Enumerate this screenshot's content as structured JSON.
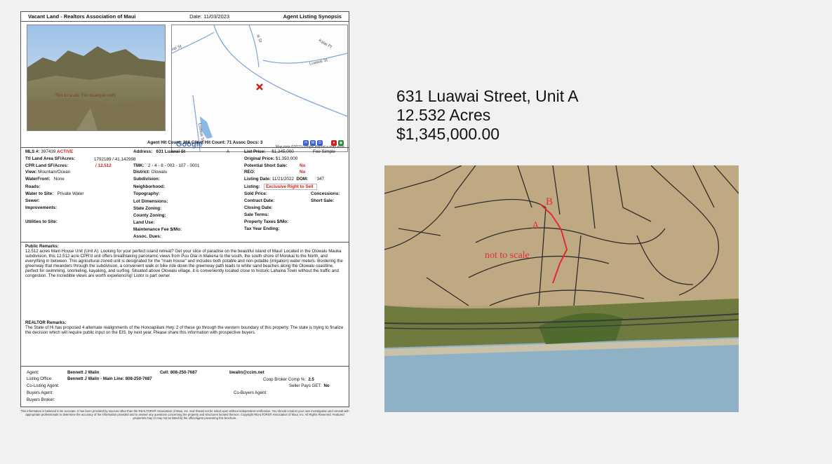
{
  "header": {
    "left": "Vacant Land - Realtors Association of Maui",
    "date": "Date:  11/03/2023",
    "right": "Agent Listing Synopsis"
  },
  "photo": {
    "watermark": "Not to scale. For example only"
  },
  "map": {
    "street_labels": [
      "Kalai Pl",
      "Luawai St",
      "Luawai St",
      "ai St",
      "wai St"
    ],
    "google": "Google",
    "attribution": "Map data ©2023 Google   Report a map error"
  },
  "counts": {
    "text": "Agent Hit Count:  266   Client Hit Count:  71    Assoc Docs:  3"
  },
  "colors": {
    "active": "#cc1f1f",
    "annotation": "#dd3333",
    "icon_blue": "#3a5fc8",
    "icon_red": "#d02020"
  },
  "col1": [
    {
      "k": "MLS #:",
      "v": "397439",
      "badge": "ACTIVE"
    },
    {
      "k": "Ttl Land Area SF/Acres:",
      "v": "1792189  /  41.142998"
    },
    {
      "k": "CPR Land SF/Acres:",
      "v": "/ 12.512"
    },
    {
      "k": "View:",
      "v": "Mountain/Ocean"
    },
    {
      "k": "WaterFront:",
      "v": "None"
    },
    {
      "k": "Roads:",
      "v": ""
    },
    {
      "k": "Water to Site:",
      "v": "Private Water"
    },
    {
      "k": "Sewer:",
      "v": ""
    },
    {
      "k": "Improvements:",
      "v": ""
    },
    {
      "k": "Utilities to Site:",
      "v": ""
    }
  ],
  "col2": [
    {
      "k": "Address:",
      "v": "631 Luawai St",
      "extra": "A"
    },
    {
      "k": "TMK:",
      "v": "2 - 4 - 8 - 003 - 107 - 0001"
    },
    {
      "k": "District:",
      "v": "Olowalu"
    },
    {
      "k": "Subdivision:",
      "v": ""
    },
    {
      "k": "Neighborhood:",
      "v": ""
    },
    {
      "k": "Topography:",
      "v": ""
    },
    {
      "k": "Lot Dimensions:",
      "v": ""
    },
    {
      "k": "State Zoning:",
      "v": ""
    },
    {
      "k": "County Zoning:",
      "v": ""
    },
    {
      "k": "Land Use:",
      "v": ""
    },
    {
      "k": "Maintenance Fee $/Mo:",
      "v": ""
    },
    {
      "k": "Assoc. Dues:",
      "v": ""
    }
  ],
  "col3": [
    {
      "k": "List Price:",
      "v": "$1,345,000",
      "extra": "Fee Simple"
    },
    {
      "k": "Original Price:",
      "v": "$1,350,000"
    },
    {
      "k": "Potential Short Sale:",
      "v": "No"
    },
    {
      "k": "REO:",
      "v": "No"
    },
    {
      "k": "Listing Date:",
      "v": "11/21/2022",
      "extra": "DOM:",
      "extra2": "347"
    },
    {
      "k": "Listing:",
      "v": "Exclusive Right to Sell"
    },
    {
      "k": "Sold Price:",
      "v": "",
      "extra": "Concessions:"
    },
    {
      "k": "Contract Date:",
      "v": "",
      "extra": "Short Sale:"
    },
    {
      "k": "Closing Date:",
      "v": ""
    },
    {
      "k": "Sale Terms:",
      "v": ""
    },
    {
      "k": "Property Taxes $/Mo:",
      "v": ""
    },
    {
      "k": "Tax Year Ending:",
      "v": ""
    }
  ],
  "remarks": {
    "public_title": "Public Remarks:",
    "public_text": "12.512 acres Main House Unit (Unit A): Looking for your perfect island retreat? Get your slice of paradise on the beautiful island of Maui! Located in the Olowalu Mauka subdivision, this 12.512 acre CPR'd unit offers breathtaking panoramic views from Puu Olai in Makena to the south, the south shore of Molokai to the North, and everything in between. This agricultural-zoned unit is designated for the \"main house\" and includes both potable and non-potable (irrigation) water meters. Bordering the greenway that meanders through the subdivision, a convenient walk or bike ride down the greenway path leads to white sand beaches along the Olowalu coastline, perfect for swimming, snorkeling, kayaking, and surfing. Situated above Olowalu village, it is conveniently located close to historic Lahaina Town without the traffic and congestion. The incredible views are worth experiencing! Listor is part owner.",
    "realtor_title": "REALTOR Remarks:",
    "realtor_text": "The State of Hi has proposed 4 alternate realignments of the Honoapiilani Hwy. 2 of these go through the western boundary of this property. The state is trying to finalize the decision which will require public input on the EIS, by next year. Please share this information with prospective buyers."
  },
  "agent": {
    "agent_k": "Agent:",
    "agent_v": "Bennett J Walin",
    "cell": "Cell: 808-250-7687",
    "email": "bwalin@ccim.net",
    "office_k": "Listing Office:",
    "office_v": "Bennett J Walin - Main Line: 808-250-7687",
    "colist_k": "Co-Listing Agent:",
    "coop": "Coop Broker Comp %:",
    "coop_v": "2.5",
    "seller": "Seller Pays GET:",
    "seller_v": "No",
    "buyers_k": "Buyers Agent:",
    "cobuyers": "Co-Buyers Agent:",
    "broker_k": "Buyers Broker:"
  },
  "disclaimer": "This information is believed to be accurate. It has been provided by sources other than the REALTORS® Association of Maui, Inc. and should not be relied upon without independent verification. You should conduct your own investigation and consult with appropriate professionals to determine the accuracy of the information provided and to answer any questions concerning the property and structures located thereon. Copyright REALTORS® Association of Maui, Inc. All Rights Reserved. Featured properties may or may not be listed by the office/agent presenting this brochure.",
  "info": {
    "address": "631 Luawai Street, Unit A",
    "acres": "12.532 Acres",
    "price": "$1,345,000.00"
  },
  "aerial": {
    "not_to_scale": "not to scale",
    "label_a": "A",
    "label_b": "B"
  }
}
